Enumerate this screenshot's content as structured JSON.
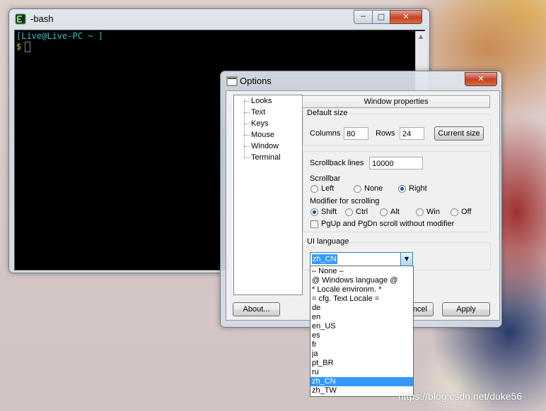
{
  "terminal": {
    "title": "-bash",
    "prompt_line": "[Live@Live-PC ~ ]",
    "cursor_line": "$ ",
    "controls": {
      "minimize": "─",
      "maximize": "□",
      "close": "✕"
    }
  },
  "options": {
    "title": "Options",
    "close_label": "✕",
    "tree": [
      "Looks",
      "Text",
      "Keys",
      "Mouse",
      "Window",
      "Terminal"
    ],
    "section_header": "Window properties",
    "default_size": {
      "legend": "Default size",
      "columns_label": "Columns",
      "columns_value": "80",
      "rows_label": "Rows",
      "rows_value": "24",
      "current_size_button": "Current size"
    },
    "scrollback_label": "Scrollback lines",
    "scrollback_value": "10000",
    "scrollbar": {
      "label": "Scrollbar",
      "left": "Left",
      "none": "None",
      "right": "Right",
      "selected": "Right"
    },
    "modifier": {
      "label": "Modifier for scrolling",
      "shift": "Shift",
      "ctrl": "Ctrl",
      "alt": "Alt",
      "win": "Win",
      "off": "Off",
      "selected": "Shift"
    },
    "pgup_checkbox": "PgUp and PgDn scroll without modifier",
    "ui_language": {
      "legend": "UI language",
      "value": "zh_CN",
      "options": [
        "– None –",
        "@ Windows language @",
        "* Locale environm. *",
        "= cfg. Text Locale =",
        "de",
        "en",
        "en_US",
        "es",
        "fr",
        "ja",
        "pt_BR",
        "ru",
        "zh_CN",
        "zh_TW"
      ],
      "highlighted": "zh_CN"
    },
    "about_button": "About...",
    "cancel_button_partial": "ncel",
    "apply_button": "Apply"
  },
  "watermark": "https://blog.csdn.net/duke56",
  "colors": {
    "terminal_text": "#3fbcc8",
    "selection": "#3399ff"
  }
}
